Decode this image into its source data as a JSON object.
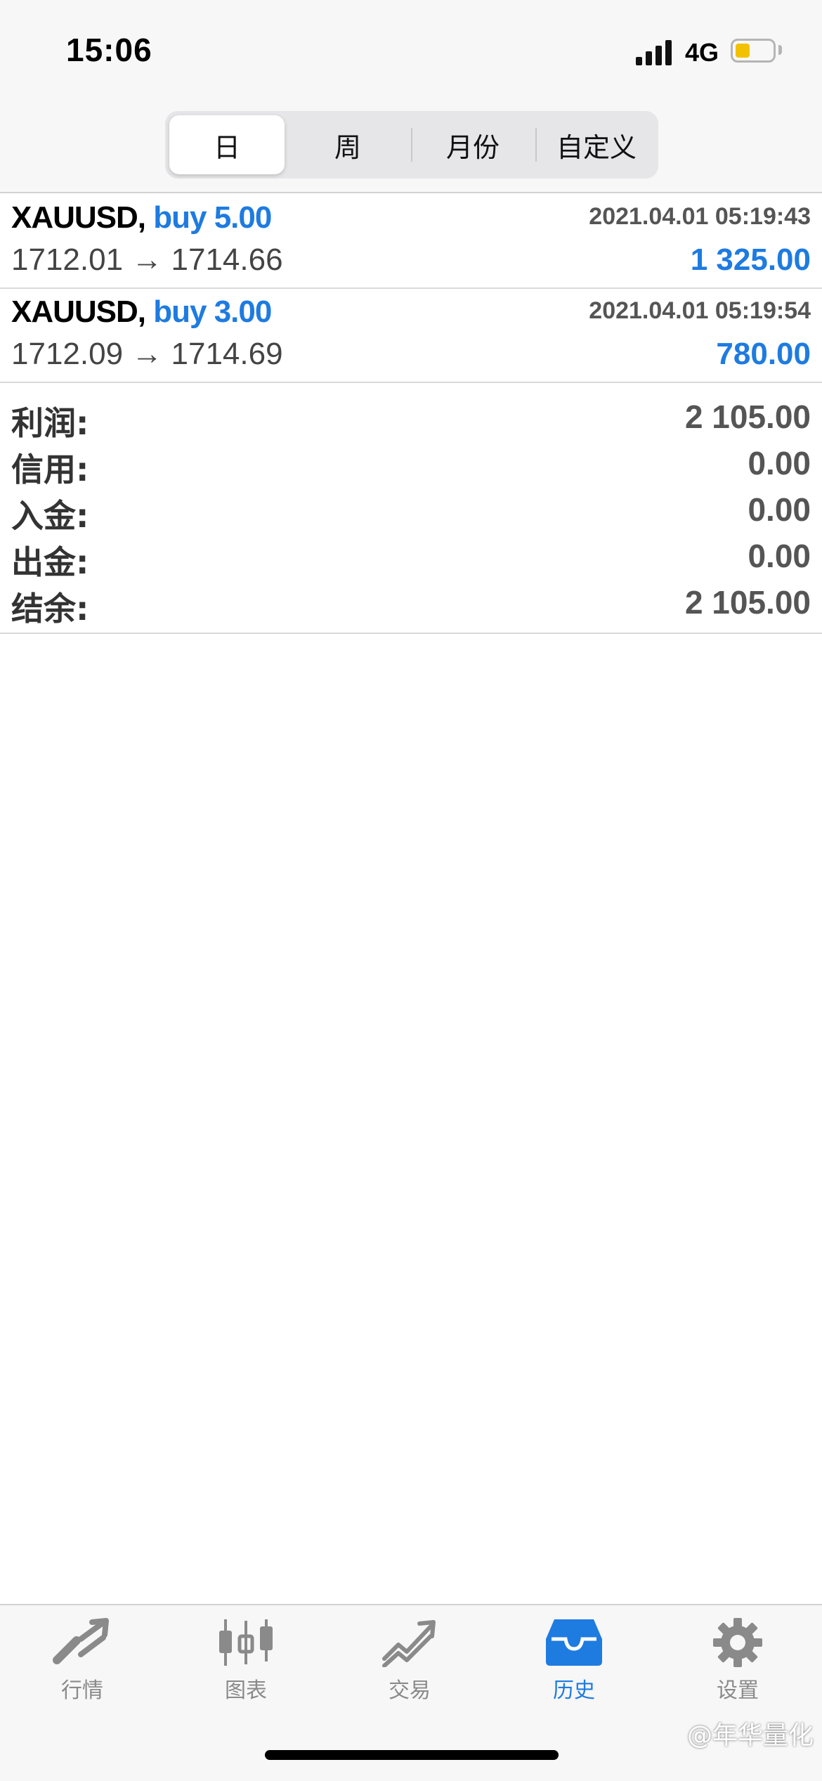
{
  "status_bar": {
    "time": "15:06",
    "network": "4G"
  },
  "segments": [
    {
      "label": "日",
      "active": true
    },
    {
      "label": "周",
      "active": false
    },
    {
      "label": "月份",
      "active": false
    },
    {
      "label": "自定义",
      "active": false
    }
  ],
  "trades": [
    {
      "symbol": "XAUUSD,",
      "direction": "buy 5.00",
      "time": "2021.04.01 05:19:43",
      "prices": "1712.01 → 1714.66",
      "profit": "1 325.00"
    },
    {
      "symbol": "XAUUSD,",
      "direction": "buy 3.00",
      "time": "2021.04.01 05:19:54",
      "prices": "1712.09 → 1714.69",
      "profit": "780.00"
    }
  ],
  "summary": [
    {
      "label": "利润:",
      "value": "2 105.00"
    },
    {
      "label": "信用:",
      "value": "0.00"
    },
    {
      "label": "入金:",
      "value": "0.00"
    },
    {
      "label": "出金:",
      "value": "0.00"
    },
    {
      "label": "结余:",
      "value": "2 105.00"
    }
  ],
  "tabs": [
    {
      "label": "行情",
      "icon": "quotes-icon",
      "active": false
    },
    {
      "label": "图表",
      "icon": "chart-icon",
      "active": false
    },
    {
      "label": "交易",
      "icon": "trade-icon",
      "active": false
    },
    {
      "label": "历史",
      "icon": "history-icon",
      "active": true
    },
    {
      "label": "设置",
      "icon": "settings-icon",
      "active": false
    }
  ],
  "watermark": "@年华量化",
  "colors": {
    "accent": "#1e7be0",
    "battery": "#f2c200"
  }
}
